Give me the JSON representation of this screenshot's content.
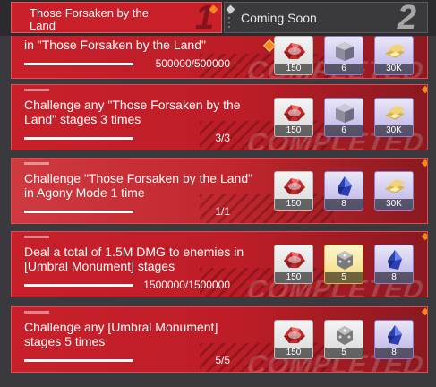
{
  "tabs": [
    {
      "label": "Those Forsaken by the Land",
      "number": "1",
      "active": true
    },
    {
      "label": "Coming Soon",
      "number": "2",
      "active": false
    }
  ],
  "missions": [
    {
      "title": "in \"Those Forsaken by the Land\"",
      "progress": "500000/500000",
      "completed": true,
      "rewards": [
        {
          "qty": "150",
          "icon": "red-crystal-icon"
        },
        {
          "qty": "6",
          "icon": "metal-chest-icon"
        },
        {
          "qty": "30K",
          "icon": "gold-bars-icon"
        }
      ]
    },
    {
      "title": "Challenge any \"Those Forsaken by the Land\" stages 3 times",
      "progress": "3/3",
      "completed": true,
      "rewards": [
        {
          "qty": "150",
          "icon": "red-crystal-icon"
        },
        {
          "qty": "6",
          "icon": "metal-chest-icon"
        },
        {
          "qty": "30K",
          "icon": "gold-bars-icon"
        }
      ]
    },
    {
      "title": "Challenge \"Those Forsaken by the Land\" in Agony Mode 1 time",
      "progress": "1/1",
      "completed": false,
      "rewards": [
        {
          "qty": "150",
          "icon": "red-crystal-icon"
        },
        {
          "qty": "8",
          "icon": "blue-crystal-icon"
        },
        {
          "qty": "30K",
          "icon": "gold-bars-icon"
        }
      ]
    },
    {
      "title": "Deal a total of 1.5M DMG to enemies in [Umbral Monument] stages",
      "progress": "1500000/1500000",
      "completed": true,
      "rewards": [
        {
          "qty": "150",
          "icon": "red-crystal-icon"
        },
        {
          "qty": "5",
          "icon": "dice-cube-icon"
        },
        {
          "qty": "8",
          "icon": "blue-crystal-icon"
        }
      ]
    },
    {
      "title": "Challenge any [Umbral Monument] stages 5 times",
      "progress": "5/5",
      "completed": true,
      "rewards": [
        {
          "qty": "150",
          "icon": "red-crystal-icon"
        },
        {
          "qty": "5",
          "icon": "dice-cube-icon"
        },
        {
          "qty": "8",
          "icon": "blue-crystal-icon"
        }
      ]
    }
  ],
  "stamp_text": "COMPLETED",
  "colors": {
    "accent": "#c8202b",
    "highlight": "#f28a1a"
  }
}
